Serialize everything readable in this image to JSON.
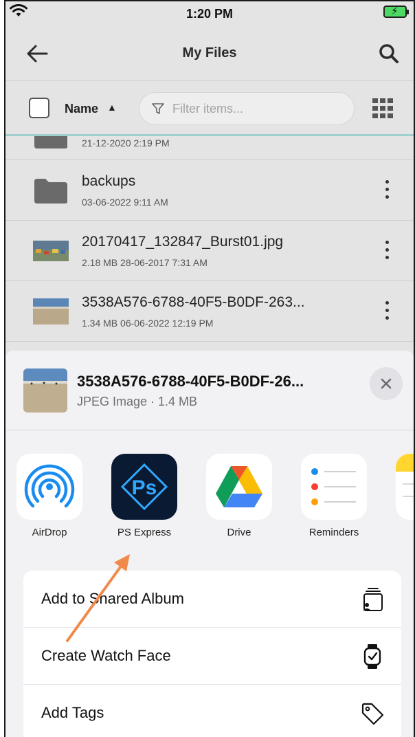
{
  "status_bar": {
    "time": "1:20 PM"
  },
  "header": {
    "title": "My Files"
  },
  "filter_row": {
    "sort_label": "Name",
    "sort_direction": "▲",
    "filter_placeholder": "Filter items..."
  },
  "files": [
    {
      "name": "",
      "meta": "21-12-2020 2:19 PM",
      "type": "folder"
    },
    {
      "name": "backups",
      "meta": "03-06-2022 9:11 AM",
      "type": "folder"
    },
    {
      "name": "20170417_132847_Burst01.jpg",
      "meta": "2.18 MB 28-06-2017 7:31 AM",
      "type": "image"
    },
    {
      "name": "3538A576-6788-40F5-B0DF-263...",
      "meta": "1.34 MB 06-06-2022 12:19 PM",
      "type": "image"
    }
  ],
  "share_sheet": {
    "title": "3538A576-6788-40F5-B0DF-26...",
    "subtitle": "JPEG Image · 1.4 MB",
    "apps": [
      {
        "label": "AirDrop",
        "icon": "airdrop-icon"
      },
      {
        "label": "PS Express",
        "icon": "ps-express-icon"
      },
      {
        "label": "Drive",
        "icon": "google-drive-icon"
      },
      {
        "label": "Reminders",
        "icon": "reminders-icon"
      }
    ],
    "actions": [
      {
        "label": "Add to Shared Album",
        "icon": "shared-album-icon"
      },
      {
        "label": "Create Watch Face",
        "icon": "watch-icon"
      },
      {
        "label": "Add Tags",
        "icon": "tag-icon"
      }
    ]
  },
  "colors": {
    "accent_arrow": "#f08a4b",
    "divider_teal": "#9fcfcf",
    "battery_green": "#4cd964"
  }
}
